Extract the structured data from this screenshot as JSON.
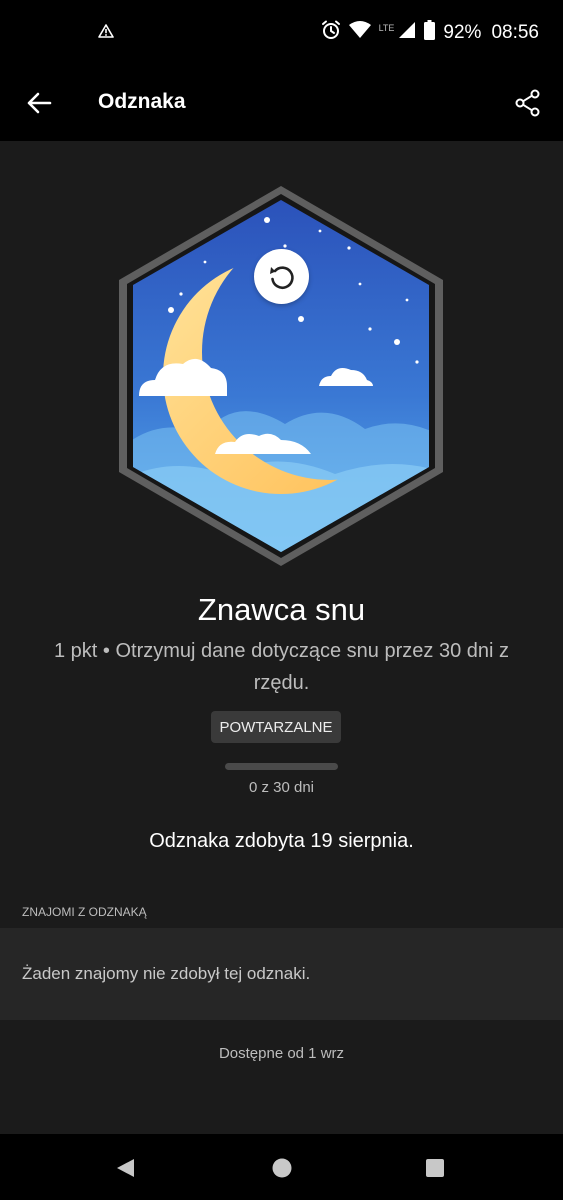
{
  "status_bar": {
    "battery": "92%",
    "time": "08:56",
    "network": "LTE"
  },
  "app_bar": {
    "title": "Odznaka"
  },
  "badge": {
    "name": "Znawca snu",
    "description": "1 pkt • Otrzymuj dane dotyczące snu przez 30 dni z rzędu.",
    "tag": "POWTARZALNE",
    "progress_text": "0 z 30 dni",
    "progress_fraction": 0,
    "earned_text": "Odznaka zdobyta 19 sierpnia."
  },
  "friends": {
    "header": "ZNAJOMI Z ODZNAKĄ",
    "empty_text": "Żaden znajomy nie zdobył tej odznaki."
  },
  "available_text": "Dostępne od 1 wrz",
  "colors": {
    "background": "#1b1b1b",
    "bar": "#000000",
    "badge_sky_top": "#2a4fb8",
    "badge_sky_bottom": "#5db2ee",
    "moon": "#ffcc66",
    "hex_border": "#5f5f5f"
  }
}
